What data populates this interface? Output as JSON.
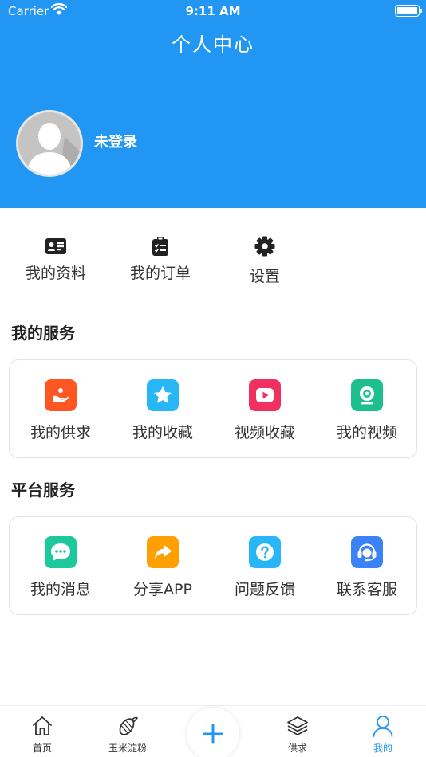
{
  "status_bar": {
    "carrier": "Carrier",
    "time": "9:11 AM"
  },
  "header": {
    "title": "个人中心",
    "username": "未登录",
    "bg_color": "#2196F3"
  },
  "quick_actions": [
    {
      "label": "我的资料",
      "icon": "id-card-icon"
    },
    {
      "label": "我的订单",
      "icon": "clipboard-list-icon"
    },
    {
      "label": "设置",
      "icon": "gear-icon"
    }
  ],
  "my_services": {
    "title": "我的服务",
    "items": [
      {
        "label": "我的供求",
        "icon": "hand-supply-icon",
        "color": "#FF5722"
      },
      {
        "label": "我的收藏",
        "icon": "star-icon",
        "color": "#29B6F6"
      },
      {
        "label": "视频收藏",
        "icon": "play-icon",
        "color": "#F0305E"
      },
      {
        "label": "我的视频",
        "icon": "webcam-icon",
        "color": "#1DBF8E"
      }
    ]
  },
  "platform_services": {
    "title": "平台服务",
    "items": [
      {
        "label": "我的消息",
        "icon": "chat-bubble-icon",
        "color": "#1DC99A"
      },
      {
        "label": "分享APP",
        "icon": "share-arrow-icon",
        "color": "#FF9F00"
      },
      {
        "label": "问题反馈",
        "icon": "question-icon",
        "color": "#29B6F6"
      },
      {
        "label": "联系客服",
        "icon": "headset-icon",
        "color": "#3B82F6"
      }
    ]
  },
  "tabbar": {
    "active_color": "#2196F3",
    "tabs": [
      {
        "label": "首页",
        "icon": "home-icon"
      },
      {
        "label": "玉米淀粉",
        "icon": "corn-icon"
      },
      {
        "label": "供求",
        "icon": "layers-icon"
      },
      {
        "label": "我的",
        "icon": "user-icon",
        "active": true
      }
    ],
    "add_icon": "plus-icon"
  }
}
